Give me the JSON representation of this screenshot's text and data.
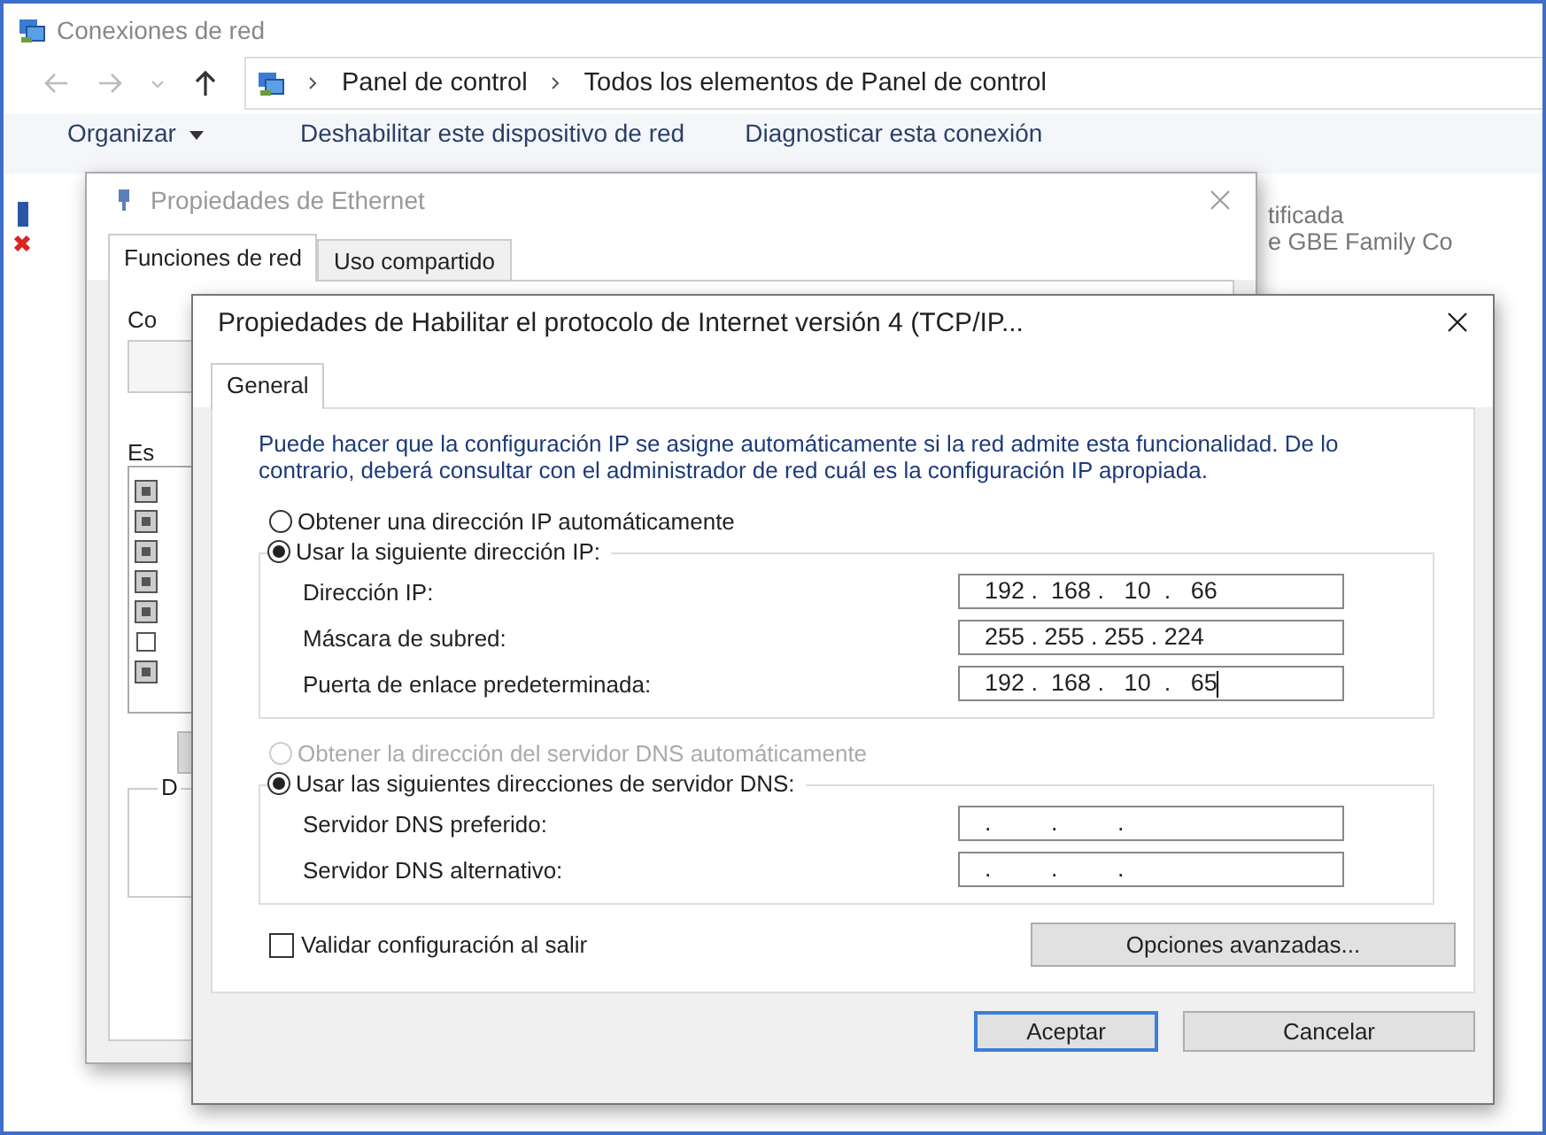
{
  "explorer": {
    "title": "Conexiones de red",
    "breadcrumb": [
      "Panel de control",
      "Todos los elementos de Panel de control"
    ],
    "toolbar": [
      "Organizar",
      "Deshabilitar este dispositivo de red",
      "Diagnosticar esta conexión"
    ],
    "connection_lines": [
      "tificada",
      "e GBE Family Co"
    ]
  },
  "ethernet": {
    "title": "Propiedades de Ethernet",
    "tabs": [
      {
        "label": "Funciones de red",
        "selected": true
      },
      {
        "label": "Uso compartido",
        "selected": false
      }
    ],
    "labels": [
      "Co",
      "Es",
      "D"
    ],
    "items": [
      {
        "checked": true
      },
      {
        "checked": true
      },
      {
        "checked": true
      },
      {
        "checked": true
      },
      {
        "checked": true
      },
      {
        "checked": false
      },
      {
        "checked": true
      }
    ]
  },
  "ipv4": {
    "title": "Propiedades de Habilitar el protocolo de Internet versión 4 (TCP/IP...",
    "tabs": [
      {
        "label": "General",
        "selected": true
      }
    ],
    "description": "Puede hacer que la configuración IP se asigne automáticamente si la red admite esta funcionalidad. De lo contrario, deberá consultar con el administrador de red cuál es la configuración IP apropiada.",
    "ip_options": [
      {
        "label": "Obtener una dirección IP automáticamente",
        "selected": false,
        "disabled": false
      },
      {
        "label": "Usar la siguiente dirección IP:",
        "selected": true,
        "disabled": false
      }
    ],
    "ip_fields": [
      {
        "label": "Dirección IP:",
        "value": "192 .  168 .   10  .   66"
      },
      {
        "label": "Máscara de subred:",
        "value": "255 . 255 . 255 . 224"
      },
      {
        "label": "Puerta de enlace predeterminada:",
        "value": "192 .  168 .   10  .   65",
        "focused": true
      }
    ],
    "dns_options": [
      {
        "label": "Obtener la dirección del servidor DNS automáticamente",
        "selected": false,
        "disabled": true
      },
      {
        "label": "Usar las siguientes direcciones de servidor DNS:",
        "selected": true,
        "disabled": false
      }
    ],
    "dns_fields": [
      {
        "label": "Servidor DNS preferido:",
        "value": ".         .         ."
      },
      {
        "label": "Servidor DNS alternativo:",
        "value": ".         .         ."
      }
    ],
    "validate": {
      "label": "Validar configuración al salir",
      "checked": false
    },
    "advanced_button": "Opciones avanzadas...",
    "buttons": [
      {
        "label": "Aceptar",
        "default": true
      },
      {
        "label": "Cancelar",
        "default": false
      }
    ]
  }
}
